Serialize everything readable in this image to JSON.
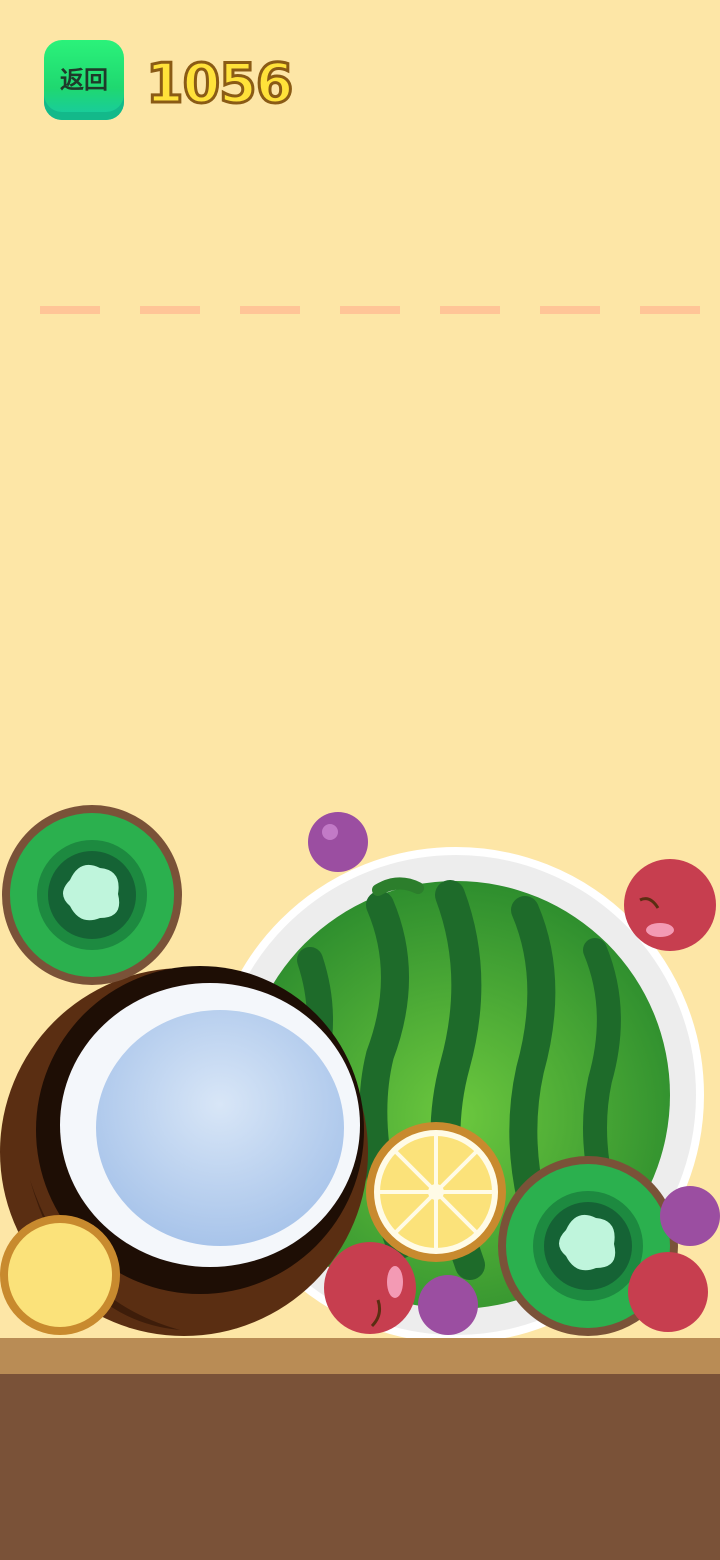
{
  "header": {
    "back_label": "返回",
    "score": "1056"
  },
  "colors": {
    "background": "#FDE6A6",
    "deadline": "#FFC597",
    "ground_top": "#B98C55",
    "ground": "#7A5238",
    "back_button": "#1FD870",
    "score_fill": "#FFE23A",
    "score_outline": "#8A5B15"
  },
  "fruits": [
    {
      "kind": "watermelon"
    },
    {
      "kind": "coconut"
    },
    {
      "kind": "kiwi"
    },
    {
      "kind": "kiwi"
    },
    {
      "kind": "lemon"
    },
    {
      "kind": "lemon"
    },
    {
      "kind": "cherry"
    },
    {
      "kind": "cherry"
    },
    {
      "kind": "cherry"
    },
    {
      "kind": "grape"
    },
    {
      "kind": "grape"
    },
    {
      "kind": "grape"
    }
  ]
}
